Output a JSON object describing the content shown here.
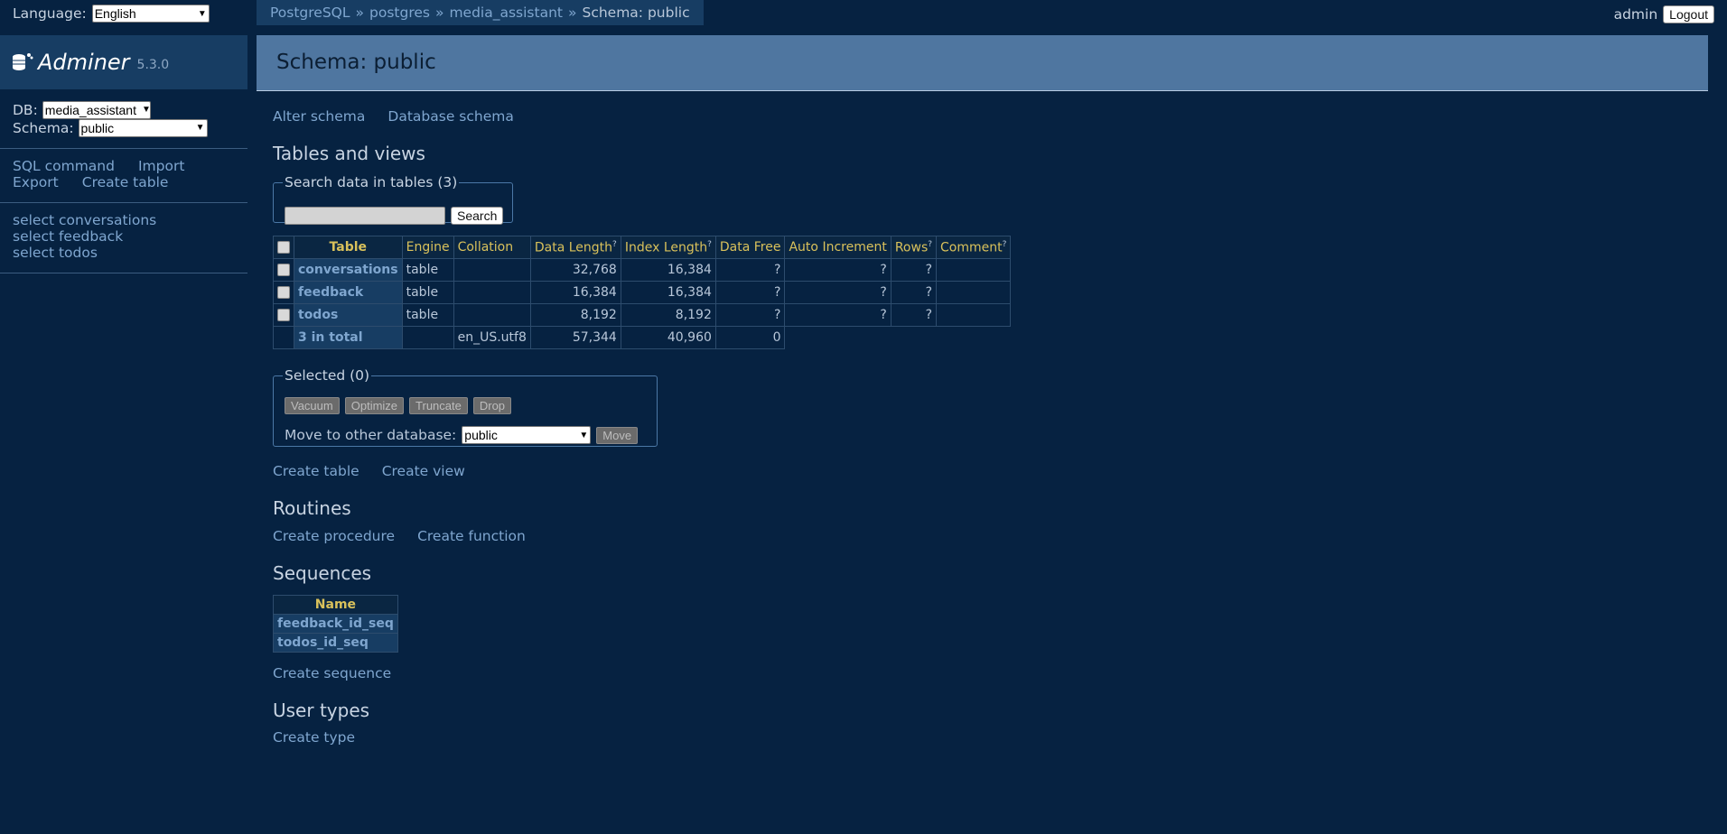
{
  "language": {
    "label": "Language:",
    "value": "English"
  },
  "logo": {
    "app": "Adminer",
    "version": "5.3.0"
  },
  "sidebar": {
    "db_label": "DB:",
    "db_value": "media_assistant",
    "schema_label": "Schema:",
    "schema_value": "public",
    "commands": [
      "SQL command",
      "Import",
      "Export",
      "Create table"
    ],
    "tables": [
      "select conversations",
      "select feedback",
      "select todos"
    ]
  },
  "breadcrumb": {
    "items": [
      "PostgreSQL",
      "postgres",
      "media_assistant"
    ],
    "current": "Schema: public",
    "sep": "»"
  },
  "user": {
    "name": "admin",
    "logout": "Logout"
  },
  "page_title": "Schema: public",
  "schema_links": [
    "Alter schema",
    "Database schema"
  ],
  "tables_section": {
    "heading": "Tables and views",
    "search_legend": "Search data in tables (3)",
    "search_button": "Search",
    "columns": [
      "Table",
      "Engine",
      "Collation",
      "Data Length",
      "Index Length",
      "Data Free",
      "Auto Increment",
      "Rows",
      "Comment"
    ],
    "help_mark": "?",
    "rows": [
      {
        "name": "conversations",
        "engine": "table",
        "collation": "",
        "data_length": "32,768",
        "index_length": "16,384",
        "data_free": "?",
        "auto_increment": "?",
        "rows": "?",
        "comment": ""
      },
      {
        "name": "feedback",
        "engine": "table",
        "collation": "",
        "data_length": "16,384",
        "index_length": "16,384",
        "data_free": "?",
        "auto_increment": "?",
        "rows": "?",
        "comment": ""
      },
      {
        "name": "todos",
        "engine": "table",
        "collation": "",
        "data_length": "8,192",
        "index_length": "8,192",
        "data_free": "?",
        "auto_increment": "?",
        "rows": "?",
        "comment": ""
      }
    ],
    "total": {
      "label": "3 in total",
      "collation": "en_US.utf8",
      "data_length": "57,344",
      "index_length": "40,960",
      "data_free": "0"
    }
  },
  "selected": {
    "legend": "Selected (0)",
    "buttons": [
      "Vacuum",
      "Optimize",
      "Truncate",
      "Drop"
    ],
    "move_label": "Move to other database:",
    "move_value": "public",
    "move_button": "Move"
  },
  "table_links": [
    "Create table",
    "Create view"
  ],
  "routines": {
    "heading": "Routines",
    "links": [
      "Create procedure",
      "Create function"
    ]
  },
  "sequences": {
    "heading": "Sequences",
    "column": "Name",
    "items": [
      "feedback_id_seq",
      "todos_id_seq"
    ],
    "link": "Create sequence"
  },
  "user_types": {
    "heading": "User types",
    "link": "Create type"
  }
}
